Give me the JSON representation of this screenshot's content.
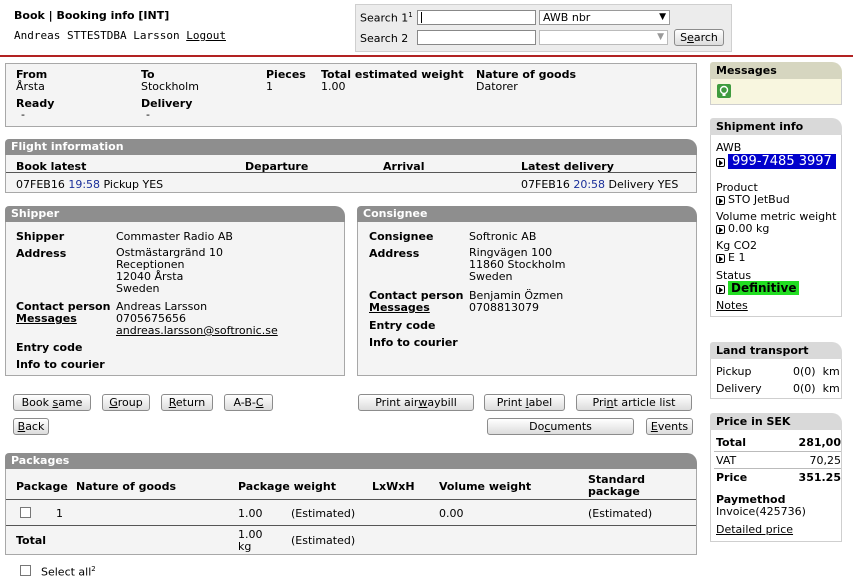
{
  "header": {
    "title": "Book | Booking info [INT]",
    "user_name": "Andreas STTESTDBA Larsson",
    "logout_label": "Logout"
  },
  "search": {
    "label1": "Search 1",
    "label1_sup": "1",
    "label2": "Search 2",
    "select1_value": "AWB nbr",
    "select2_value": "",
    "button_label": "Search",
    "button_underline": "e"
  },
  "route": {
    "from_label": "From",
    "from_value": "Årsta",
    "to_label": "To",
    "to_value": "Stockholm",
    "pieces_label": "Pieces",
    "pieces_value": "1",
    "weight_label": "Total estimated weight",
    "weight_value": "1.00",
    "nature_label": "Nature of goods",
    "nature_value": "Datorer",
    "ready_label": "Ready",
    "ready_value": "-",
    "delivery_label": "Delivery",
    "delivery_value": "-"
  },
  "flight": {
    "title": "Flight information",
    "columns": [
      "Book latest",
      "Departure",
      "Arrival",
      "Latest delivery"
    ],
    "book_date": "07FEB16",
    "book_time": "19:58",
    "book_pickup": "Pickup YES",
    "latest_date": "07FEB16",
    "latest_time": "20:58",
    "latest_delivery": "Delivery YES"
  },
  "shipper": {
    "title": "Shipper",
    "shipper_label": "Shipper",
    "shipper_value": "Commaster Radio AB",
    "address_label": "Address",
    "address_lines": [
      "Ostmästargränd 10",
      "Receptionen",
      "12040 Årsta",
      "Sweden"
    ],
    "contact_label": "Contact person",
    "contact_value": "Andreas Larsson",
    "messages_label": "Messages",
    "phone": "0705675656",
    "email": "andreas.larsson@softronic.se",
    "entry_label": "Entry code",
    "courier_label": "Info to courier"
  },
  "consignee": {
    "title": "Consignee",
    "consignee_label": "Consignee",
    "consignee_value": "Softronic AB",
    "address_label": "Address",
    "address_lines": [
      "Ringvägen 100",
      "11860 Stockholm",
      "Sweden"
    ],
    "contact_label": "Contact person",
    "contact_value": "Benjamin Özmen",
    "messages_label": "Messages",
    "phone": "0708813079",
    "entry_label": "Entry code",
    "courier_label": "Info to courier"
  },
  "actions": {
    "book_same": "Book same",
    "group": "Group",
    "return": "Return",
    "abc": "A-B-C",
    "print_airwaybill": "Print airwaybill",
    "print_label": "Print label",
    "print_article_list": "Print article list",
    "back": "Back",
    "documents": "Documents",
    "events": "Events"
  },
  "packages": {
    "title": "Packages",
    "columns": [
      "Package",
      "Nature of goods",
      "Package weight",
      "LxWxH",
      "Volume weight",
      "Standard package"
    ],
    "rows": [
      {
        "package": "1",
        "nature": "",
        "weight": "1.00",
        "weight_note": "(Estimated)",
        "lwh": "",
        "volume": "0.00",
        "standard": "(Estimated)"
      }
    ],
    "total_label": "Total",
    "total_weight": "1.00 kg",
    "total_note": "(Estimated)",
    "select_all": "Select all",
    "select_all_sup": "2"
  },
  "sidebar": {
    "messages_title": "Messages",
    "shipment_title": "Shipment info",
    "awb_label": "AWB",
    "awb_value": "999-7485 3997",
    "product_label": "Product",
    "product_value": "STO JetBud",
    "volume_label": "Volume metric weight",
    "volume_value": "0.00 kg",
    "co2_label": "Kg CO2",
    "co2_value": "E 1",
    "status_label": "Status",
    "status_value": "Definitive",
    "notes_label": "Notes",
    "land_title": "Land transport",
    "pickup_label": "Pickup",
    "pickup_value": "0(0)  km",
    "delivery_label": "Delivery",
    "delivery_value": "0(0)  km",
    "price_title": "Price in SEK",
    "total_label": "Total",
    "total_value": "281,00",
    "vat_label": "VAT",
    "vat_value": "70,25",
    "price_label": "Price",
    "price_value": "351.25",
    "paymethod_label": "Paymethod",
    "paymethod_value": "Invoice(425736)",
    "detailed_price": "Detailed price"
  },
  "colors": {
    "accent_red": "#b22222",
    "awb_bg": "#0000cc",
    "status_green": "#22dd22",
    "section_gray": "#8e8e8e"
  }
}
